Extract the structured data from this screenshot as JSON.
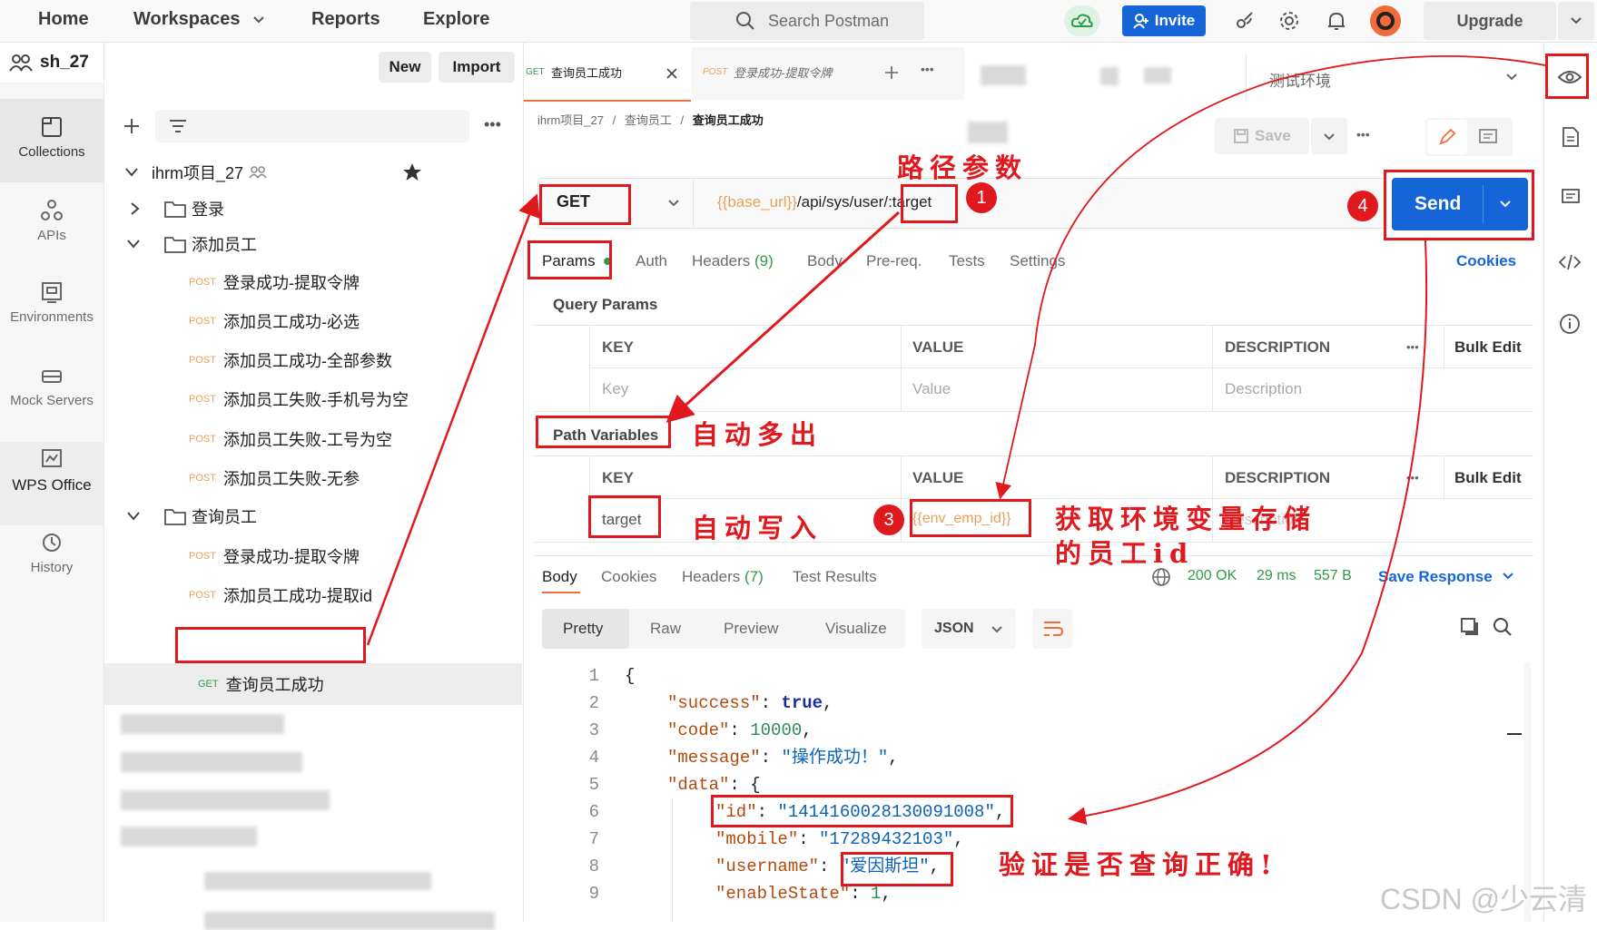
{
  "topbar": {
    "nav": [
      "Home",
      "Workspaces",
      "Reports",
      "Explore"
    ],
    "search_placeholder": "Search Postman",
    "invite_label": "Invite",
    "upgrade_label": "Upgrade"
  },
  "workspace": {
    "name": "sh_27",
    "new_label": "New",
    "import_label": "Import"
  },
  "rail": {
    "items": [
      "Collections",
      "APIs",
      "Environments",
      "Mock Servers",
      "WPS Office",
      "History"
    ]
  },
  "tree": {
    "collection": "ihrm项目_27",
    "folders": [
      "登录",
      "添加员工",
      "查询员工"
    ],
    "requests_add": [
      {
        "method": "POST",
        "name": "登录成功-提取令牌"
      },
      {
        "method": "POST",
        "name": "添加员工成功-必选"
      },
      {
        "method": "POST",
        "name": "添加员工成功-全部参数"
      },
      {
        "method": "POST",
        "name": "添加员工失败-手机号为空"
      },
      {
        "method": "POST",
        "name": "添加员工失败-工号为空"
      },
      {
        "method": "POST",
        "name": "添加员工失败-无参"
      }
    ],
    "requests_query": [
      {
        "method": "POST",
        "name": "登录成功-提取令牌"
      },
      {
        "method": "POST",
        "name": "添加员工成功-提取id"
      },
      {
        "method": "GET",
        "name": "查询员工成功"
      }
    ]
  },
  "tabs": [
    {
      "method": "GET",
      "name": "查询员工成功"
    },
    {
      "method": "POST",
      "name": "登录成功-提取令牌"
    }
  ],
  "environment": "测试环境",
  "breadcrumb": [
    "ihrm项目_27",
    "查询员工",
    "查询员工成功"
  ],
  "request": {
    "method": "GET",
    "url_var": "{{base_url}}",
    "url_path": "/api/sys/user/",
    "url_param": ":target",
    "send_label": "Send",
    "save_label": "Save",
    "cookies_label": "Cookies"
  },
  "req_tabs": [
    "Params",
    "Auth",
    "Headers",
    "(9)",
    "Body",
    "Pre-req.",
    "Tests",
    "Settings"
  ],
  "query_params": {
    "title": "Query Params",
    "headers": [
      "KEY",
      "VALUE",
      "DESCRIPTION"
    ],
    "bulk_edit": "Bulk Edit",
    "placeholders": [
      "Key",
      "Value",
      "Description"
    ]
  },
  "path_variables": {
    "title": "Path Variables",
    "headers": [
      "KEY",
      "VALUE",
      "DESCRIPTION"
    ],
    "bulk_edit": "Bulk Edit",
    "row": {
      "key": "target",
      "value": "{{env_emp_id}}",
      "description": "Description"
    }
  },
  "response": {
    "tabs": [
      "Body",
      "Cookies",
      "Headers",
      "(7)",
      "Test Results"
    ],
    "status": "200 OK",
    "time": "29 ms",
    "size": "557 B",
    "save_response": "Save Response",
    "view_tabs": [
      "Pretty",
      "Raw",
      "Preview",
      "Visualize"
    ],
    "format": "JSON",
    "lines": [
      "1",
      "2",
      "3",
      "4",
      "5",
      "6",
      "7",
      "8",
      "9"
    ],
    "json": {
      "success_key": "\"success\"",
      "success_val": "true",
      "code_key": "\"code\"",
      "code_val": "10000",
      "message_key": "\"message\"",
      "message_val": "\"操作成功！\"",
      "data_key": "\"data\"",
      "id_key": "\"id\"",
      "id_val": "\"1414160028130091008\"",
      "mobile_key": "\"mobile\"",
      "mobile_val": "\"17289432103\"",
      "username_key": "\"username\"",
      "username_val": "\"爱因斯坦\"",
      "enable_key": "\"enableState\"",
      "enable_val": "1"
    }
  },
  "annotations": {
    "path_param": "路径参数",
    "auto_extra": "自动多出",
    "auto_write": "自动写入",
    "env_store_1": "获取环境变量存储",
    "env_store_2": "的员工id",
    "verify": "验证是否查询正确!",
    "badges": [
      "1",
      "3",
      "4"
    ]
  },
  "watermark": "CSDN @少云清",
  "colors": {
    "send": "#1565d8",
    "annotation": "#e0191e",
    "post": "#e8a05a",
    "get": "#2e9b48"
  }
}
